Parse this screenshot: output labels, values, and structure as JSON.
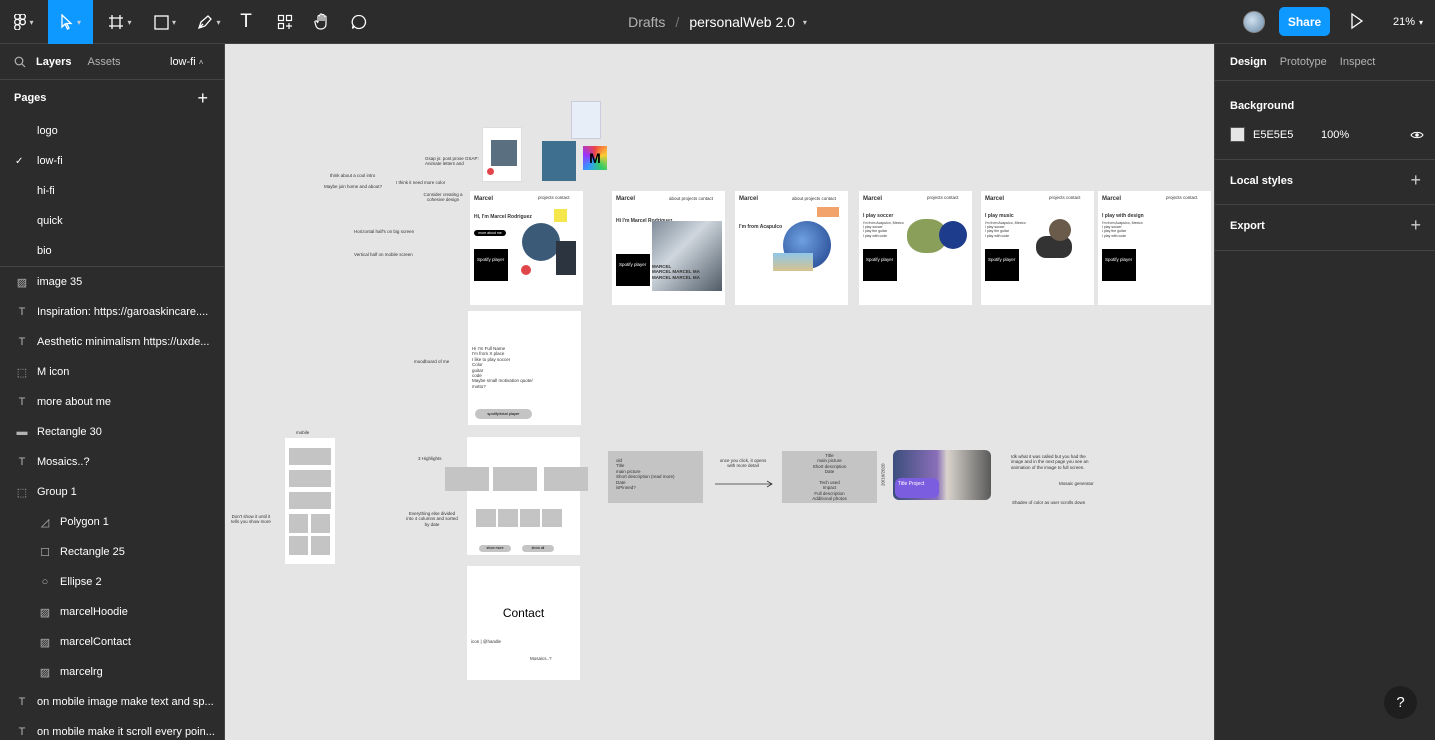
{
  "toolbar": {
    "tools": [
      "main-menu",
      "move",
      "frame",
      "shape",
      "pen",
      "text",
      "resources",
      "hand",
      "comment"
    ],
    "breadcrumb_drafts": "Drafts",
    "breadcrumb_sep": "/",
    "file_name": "personalWeb 2.0",
    "share_label": "Share",
    "zoom": "21%",
    "text_tool_glyph": "T"
  },
  "left_panel": {
    "tabs": {
      "layers": "Layers",
      "assets": "Assets"
    },
    "current_page": "low-fi",
    "pages_header": "Pages",
    "pages": [
      {
        "label": "logo",
        "selected": false
      },
      {
        "label": "low-fi",
        "selected": true
      },
      {
        "label": "hi-fi",
        "selected": false
      },
      {
        "label": "quick",
        "selected": false
      },
      {
        "label": "bio",
        "selected": false
      }
    ],
    "layers": [
      {
        "label": "image 35",
        "icon": "image-icon",
        "indent": 0
      },
      {
        "label": "Inspiration: https://garoaskincare....",
        "icon": "text-icon",
        "indent": 0
      },
      {
        "label": "Aesthetic minimalism https://uxde...",
        "icon": "text-icon",
        "indent": 0
      },
      {
        "label": "M icon",
        "icon": "frame-icon",
        "indent": 0
      },
      {
        "label": "more about me",
        "icon": "text-icon",
        "indent": 0
      },
      {
        "label": "Rectangle 30",
        "icon": "rectangle-icon",
        "indent": 0
      },
      {
        "label": "Mosaics..?",
        "icon": "text-icon",
        "indent": 0
      },
      {
        "label": "Group 1",
        "icon": "group-icon",
        "indent": 0
      },
      {
        "label": "Polygon 1",
        "icon": "polygon-icon",
        "indent": 1
      },
      {
        "label": "Rectangle 25",
        "icon": "rectangle-icon",
        "indent": 1
      },
      {
        "label": "Ellipse 2",
        "icon": "ellipse-icon",
        "indent": 1
      },
      {
        "label": "marcelHoodie",
        "icon": "image-icon",
        "indent": 1
      },
      {
        "label": "marcelContact",
        "icon": "image-icon",
        "indent": 1
      },
      {
        "label": "marcelrg",
        "icon": "image-icon",
        "indent": 1
      },
      {
        "label": "on mobile image make text and sp...",
        "icon": "text-icon",
        "indent": 0
      },
      {
        "label": "on mobile make it scroll every poin...",
        "icon": "text-icon",
        "indent": 0
      }
    ]
  },
  "right_panel": {
    "tabs": {
      "design": "Design",
      "prototype": "Prototype",
      "inspect": "Inspect"
    },
    "background_header": "Background",
    "background_hex": "E5E5E5",
    "background_opacity": "100%",
    "local_styles": "Local styles",
    "export": "Export"
  },
  "canvas_content": {
    "notes": {
      "cool_intro": "think about a cool intro",
      "maybe_join": "Maybe join home and about?",
      "more_color": "I think it need more color",
      "cohesive": "Consider creating a cohesive design",
      "gsap": "Gsap js: post prose GSAP: Animate letters and",
      "horizontal": "Horizontal half's on big screen",
      "vertical": "Vertical half on mobile screen",
      "moodboard": "moodboard of me",
      "highlights": "3 Highlights",
      "everything": "Everything else divided into 4 columns and sorted by date",
      "dont_show": "Don't show it until it tells you show more",
      "mobile": "mobile",
      "click_opens": "once you click, it opens with more detail",
      "idk": "Idk what it was called but you had the image and in the next page you see an animation of the image to full screen.",
      "mosaic_gen": "Mosaic generator",
      "shades": "Shades of color as user scrolls down",
      "date": "20/10/2020"
    },
    "frames": {
      "marcel": "Marcel",
      "nav": "projects contact",
      "nav_full": "about projects contact",
      "hi_marcel": "Hi, I'm Marcel Rodriguez",
      "hi_marcel2": "Hi I'm Marcel Rodriguez",
      "about_me_btn": "more about me",
      "spotify": "Spotify player",
      "from_acapulco": "I'm from Acapulco",
      "soccer": "I play soccer",
      "music": "I play music",
      "design": "I play with design",
      "card_lines": "I'm from Acapulco, Mexico\nI play soccer\nI play the guitar\nI play with code",
      "hi_full": "Hi I'm Full Name\nI'm from X place\nI like to play soccer\nColor\nguitar\ncode\nMaybe small motivation quote/ motto?",
      "spotify_pill": "spotify/total player",
      "show_more": "show more",
      "show_all": "show all",
      "contact": "Contact",
      "handle": "icon | @handle",
      "mosaics": "Mosaics..?",
      "proj_list": "old\nTitle\nmain picture\nShort description (read more)\nDate\nisPinned?",
      "proj_detail": "Title\nmain picture\nShort description\nDate\n\nTech used\nImpact\nFull description\nAdditional photos",
      "title_project": "Title Project",
      "marcel_repeat": "MARCEL\nMARCEL MARCEL MA\nMARCEL MARCEL MA"
    }
  }
}
